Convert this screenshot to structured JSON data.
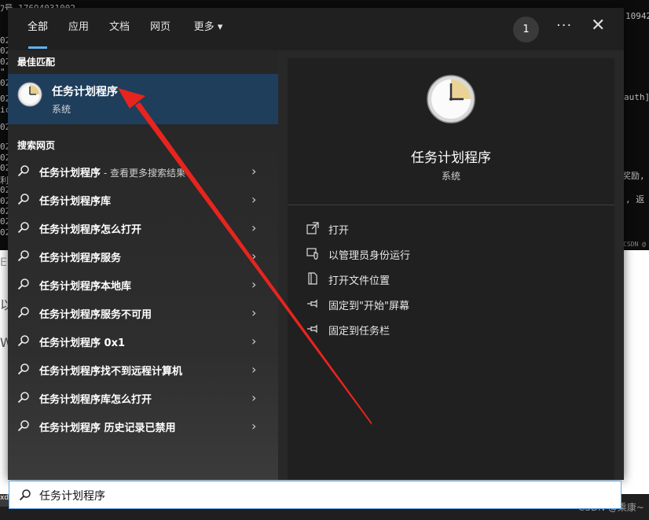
{
  "background": {
    "terminal_first_line": "ﾌ号 17694031002",
    "terminal_left_fragments": [
      "02",
      "02",
      "02",
      "\"",
      "02",
      "02",
      "ic",
      "02",
      "02",
      "02",
      "02",
      "利",
      "02",
      "02",
      "02",
      "02",
      "02"
    ],
    "right_fragments": [
      "10942",
      "auth]",
      "奖励,",
      ", 返"
    ],
    "mini_watermark": "CSDN @",
    "left_glyphs": [
      "E",
      "以",
      "W"
    ],
    "bottom_left": "xd",
    "watermark": "CSDN @乘康~"
  },
  "topbar": {
    "tabs": [
      {
        "label": "全部",
        "active": true
      },
      {
        "label": "应用",
        "active": false
      },
      {
        "label": "文档",
        "active": false
      },
      {
        "label": "网页",
        "active": false
      },
      {
        "label": "更多",
        "active": false
      }
    ],
    "more_caret": "▾",
    "badge": "1",
    "more_options": "···",
    "close": "✕"
  },
  "left": {
    "best_match_label": "最佳匹配",
    "best_match": {
      "title": "任务计划程序",
      "subtitle": "系统"
    },
    "search_web_label": "搜索网页",
    "web_results": [
      {
        "text": "任务计划程序",
        "suffix": " - 查看更多搜索结果"
      },
      {
        "text": "任务计划程序库",
        "suffix": ""
      },
      {
        "text": "任务计划程序怎么打开",
        "suffix": ""
      },
      {
        "text": "任务计划程序服务",
        "suffix": ""
      },
      {
        "text": "任务计划程序本地库",
        "suffix": ""
      },
      {
        "text": "任务计划程序服务不可用",
        "suffix": ""
      },
      {
        "text": "任务计划程序 0x1",
        "suffix": ""
      },
      {
        "text": "任务计划程序找不到远程计算机",
        "suffix": ""
      },
      {
        "text": "任务计划程序库怎么打开",
        "suffix": ""
      },
      {
        "text": "任务计划程序 历史记录已禁用",
        "suffix": ""
      }
    ],
    "chevron": "›"
  },
  "right": {
    "title": "任务计划程序",
    "subtitle": "系统",
    "actions": [
      {
        "label": "打开",
        "icon": "open-icon"
      },
      {
        "label": "以管理员身份运行",
        "icon": "shield-icon"
      },
      {
        "label": "打开文件位置",
        "icon": "file-location-icon"
      },
      {
        "label": "固定到\"开始\"屏幕",
        "icon": "pin-icon"
      },
      {
        "label": "固定到任务栏",
        "icon": "pin-icon"
      }
    ]
  },
  "search": {
    "value": "任务计划程序"
  },
  "colors": {
    "accent": "#5fb2f2",
    "selected": "#1e3e5c",
    "arrow": "#e8241e"
  }
}
